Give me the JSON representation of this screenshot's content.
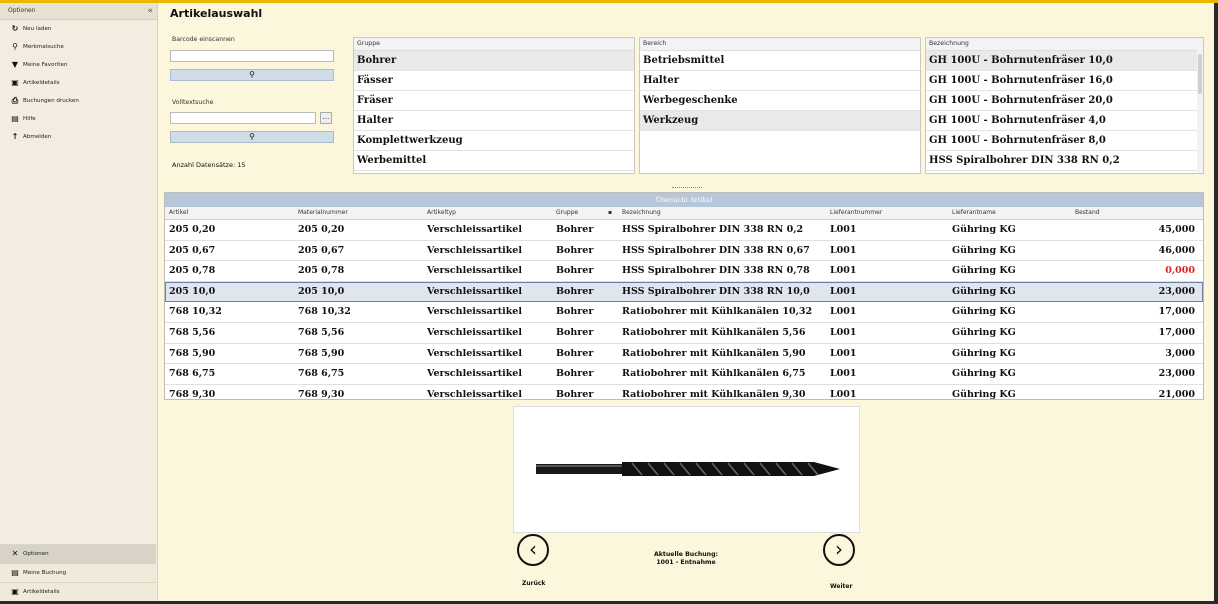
{
  "colors": {
    "accent": "#e8b700",
    "background": "#fbf6dc",
    "selected_row": "#dfe6ef",
    "negative": "#e02020"
  },
  "sidebar": {
    "header": "Optionen",
    "items": [
      {
        "icon": "refresh-icon",
        "label": "Neu laden"
      },
      {
        "icon": "search-icon",
        "label": "Merkmalsuche"
      },
      {
        "icon": "filter-icon",
        "label": "Meine Favoriten"
      },
      {
        "icon": "article-icon",
        "label": "Artikeldetails"
      },
      {
        "icon": "printer-icon",
        "label": "Buchungen drucken"
      },
      {
        "icon": "help-icon",
        "label": "Hilfe"
      },
      {
        "icon": "logout-icon",
        "label": "Abmelden"
      }
    ],
    "bottom": [
      {
        "icon": "tools-icon",
        "label": "Optionen"
      },
      {
        "icon": "booking-icon",
        "label": "Meine Buchung"
      },
      {
        "icon": "article-icon",
        "label": "Artikeldetails"
      }
    ]
  },
  "page_title": "Artikelauswahl",
  "barcode": {
    "label": "Barcode einscannen",
    "value": ""
  },
  "volltext": {
    "label": "Volltextsuche",
    "value": "",
    "more": "..."
  },
  "count_label": "Anzahl Datensätze: 15",
  "filters": {
    "gruppe": {
      "header": "Gruppe",
      "items": [
        "Bohrer",
        "Fässer",
        "Fräser",
        "Halter",
        "Komplettwerkzeug",
        "Werbemittel"
      ],
      "selected": 0
    },
    "bereich": {
      "header": "Bereich",
      "items": [
        "Betriebsmittel",
        "Halter",
        "Werbegeschenke",
        "Werkzeug"
      ],
      "selected": 3
    },
    "bezeichnung": {
      "header": "Bezeichnung",
      "items": [
        "GH 100U - Bohrnutenfräser 10,0",
        "GH 100U - Bohrnutenfräser 16,0",
        "GH 100U - Bohrnutenfräser 20,0",
        "GH 100U - Bohrnutenfräser 4,0",
        "GH 100U - Bohrnutenfräser 8,0",
        "HSS Spiralbohrer DIN 338 RN 0,2"
      ],
      "selected": 0
    }
  },
  "overview": {
    "title": "Übersicht Artikel",
    "columns": [
      "Artikel",
      "Materialnummer",
      "Artikeltyp",
      "Gruppe",
      "Bezeichnung",
      "Lieferantnummer",
      "Lieferantname",
      "Bestand"
    ],
    "rows": [
      [
        "205 0,20",
        "205 0,20",
        "Verschleissartikel",
        "Bohrer",
        "HSS Spiralbohrer DIN 338 RN 0,2",
        "L001",
        "Gühring KG",
        "45,000"
      ],
      [
        "205 0,67",
        "205 0,67",
        "Verschleissartikel",
        "Bohrer",
        "HSS Spiralbohrer DIN 338 RN 0,67",
        "L001",
        "Gühring KG",
        "46,000"
      ],
      [
        "205 0,78",
        "205 0,78",
        "Verschleissartikel",
        "Bohrer",
        "HSS Spiralbohrer DIN 338 RN 0,78",
        "L001",
        "Gühring KG",
        "0,000"
      ],
      [
        "205 10,0",
        "205 10,0",
        "Verschleissartikel",
        "Bohrer",
        "HSS Spiralbohrer DIN 338 RN 10,0",
        "L001",
        "Gühring KG",
        "23,000"
      ],
      [
        "768 10,32",
        "768 10,32",
        "Verschleissartikel",
        "Bohrer",
        "Ratiobohrer mit Kühlkanälen 10,32",
        "L001",
        "Gühring KG",
        "17,000"
      ],
      [
        "768 5,56",
        "768 5,56",
        "Verschleissartikel",
        "Bohrer",
        "Ratiobohrer mit Kühlkanälen 5,56",
        "L001",
        "Gühring KG",
        "17,000"
      ],
      [
        "768 5,90",
        "768 5,90",
        "Verschleissartikel",
        "Bohrer",
        "Ratiobohrer mit Kühlkanälen 5,90",
        "L001",
        "Gühring KG",
        "3,000"
      ],
      [
        "768 6,75",
        "768 6,75",
        "Verschleissartikel",
        "Bohrer",
        "Ratiobohrer mit Kühlkanälen 6,75",
        "L001",
        "Gühring KG",
        "23,000"
      ],
      [
        "768 9,30",
        "768 9,30",
        "Verschleissartikel",
        "Bohrer",
        "Ratiobohrer mit Kühlkanälen 9,30",
        "L001",
        "Gühring KG",
        "21,000"
      ]
    ],
    "selected_row": 3
  },
  "nav": {
    "back": "Zurück",
    "next": "Weiter"
  },
  "booking": {
    "line1": "Aktuelle Buchung:",
    "line2": "1001 - Entnahme"
  }
}
